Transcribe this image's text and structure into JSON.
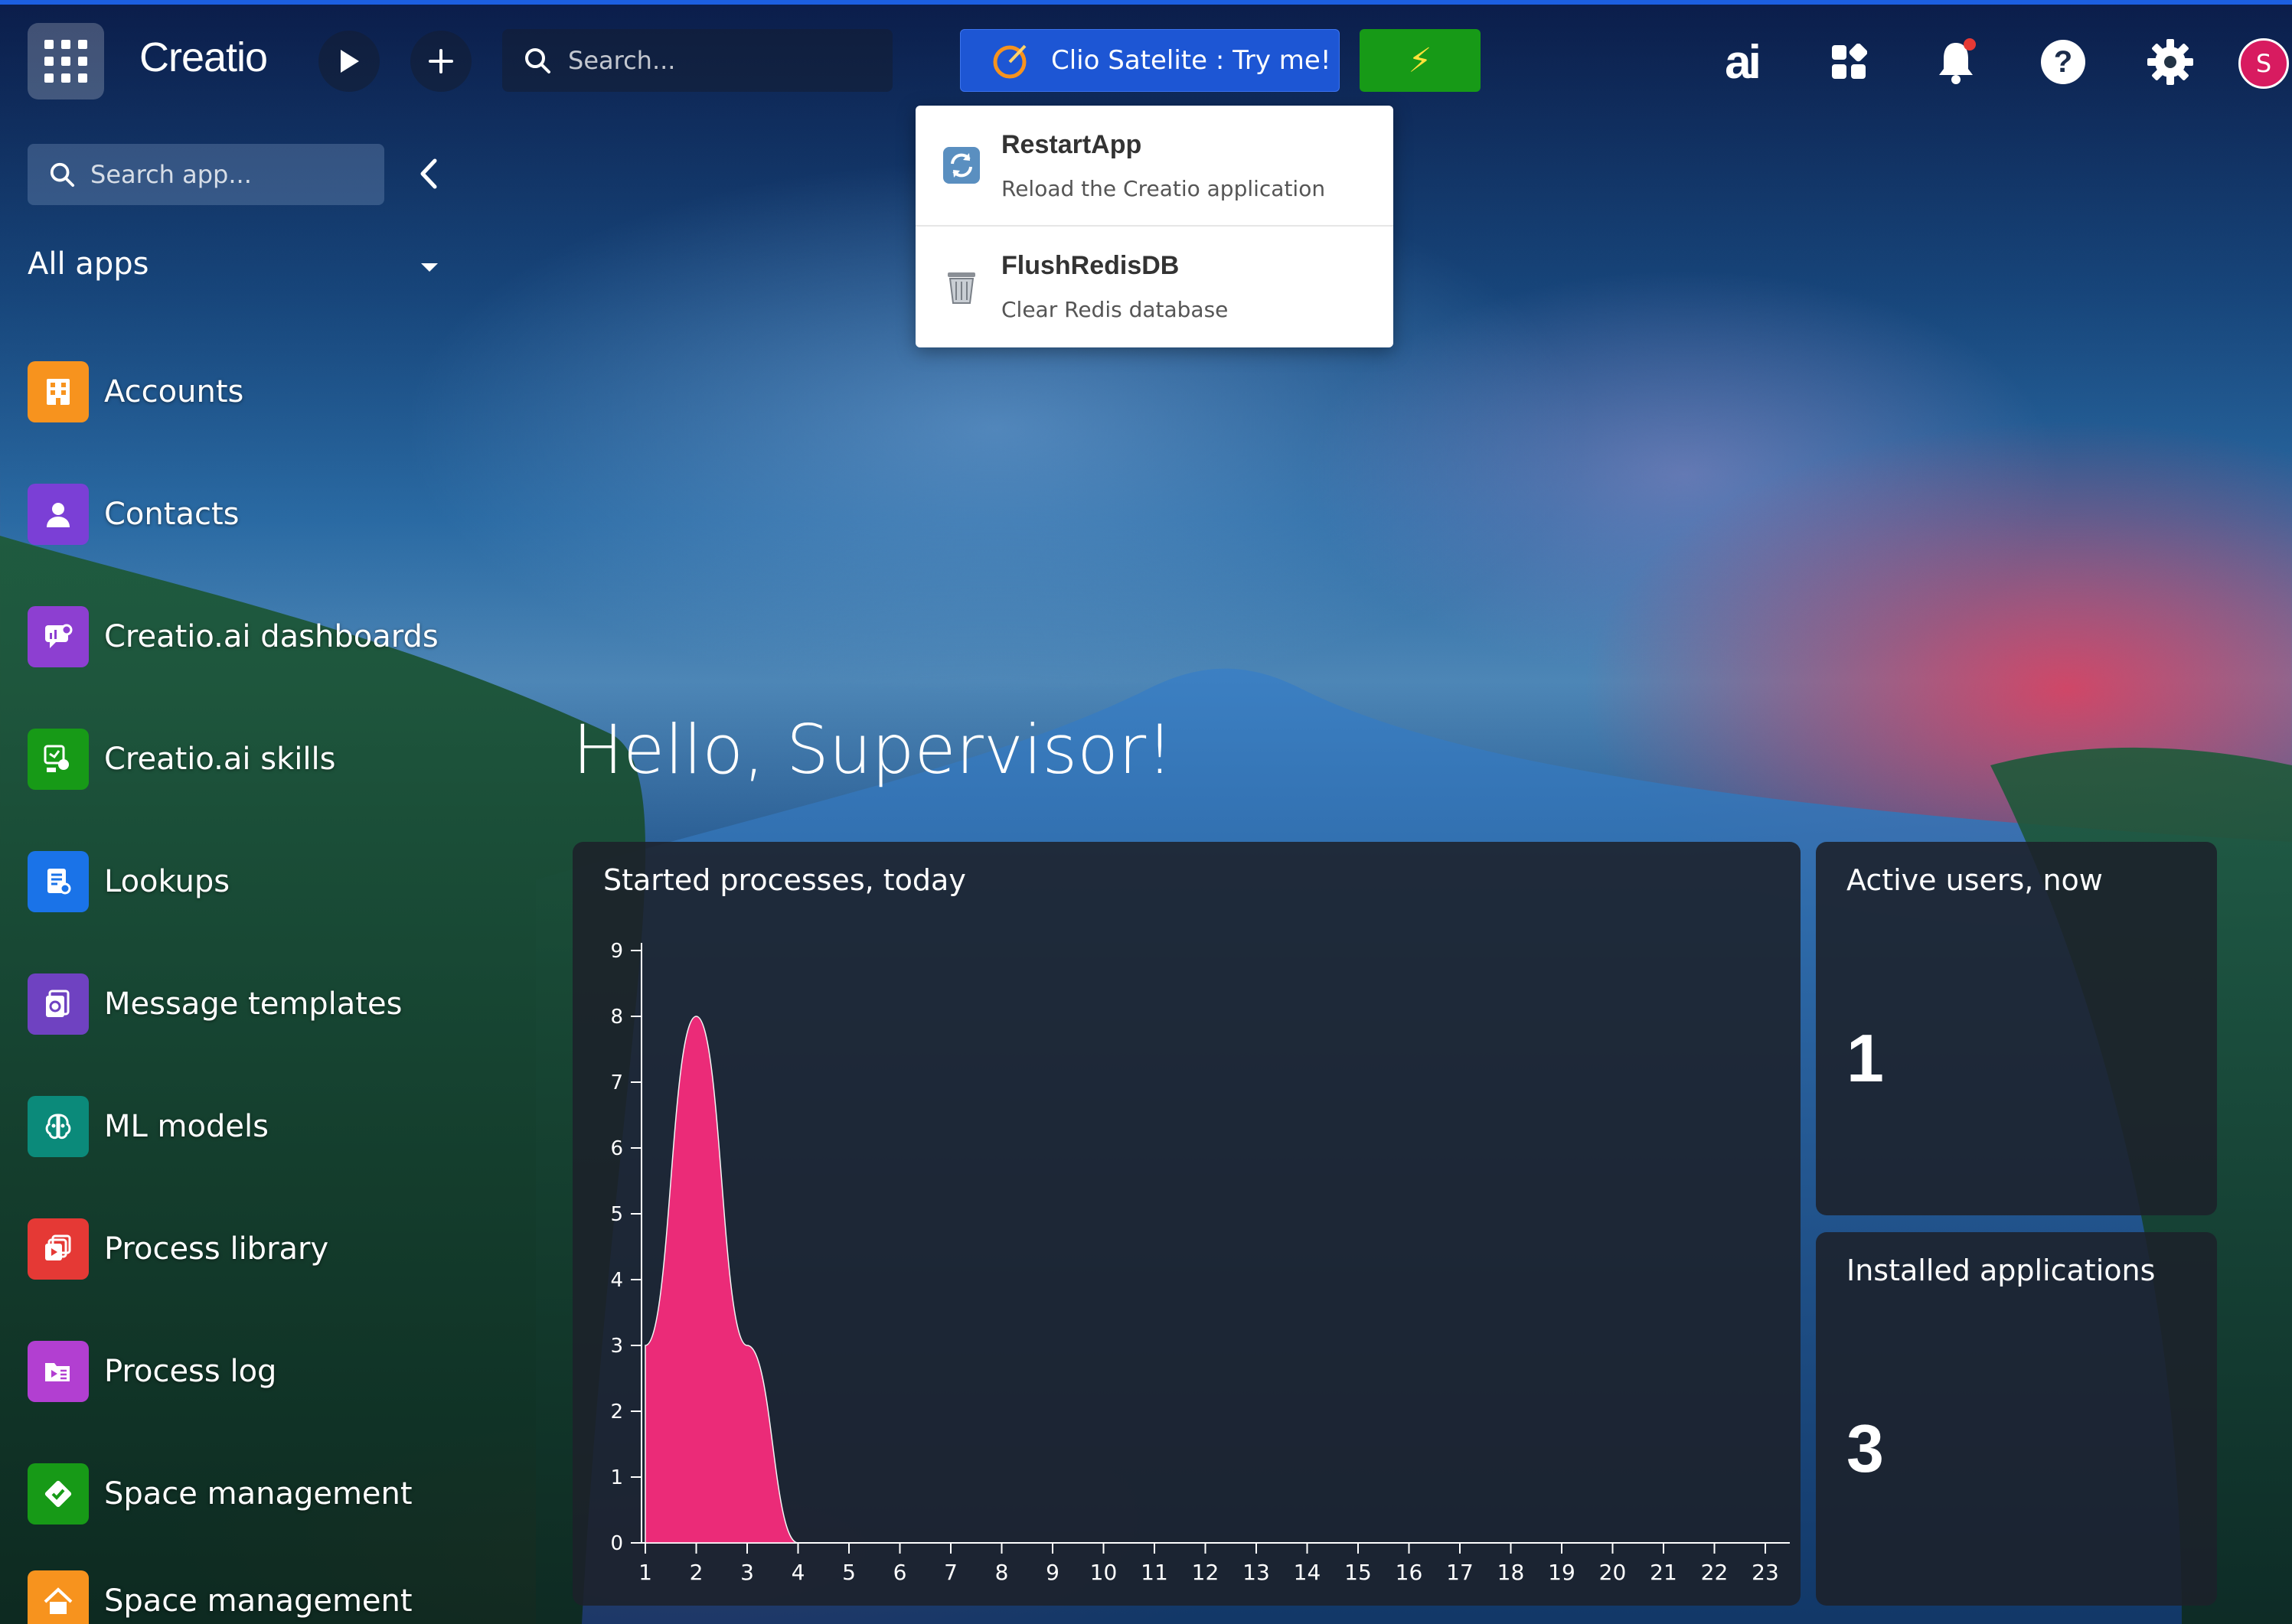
{
  "header": {
    "logo": "Creatio",
    "search_placeholder": "Search...",
    "clio_button": "Clio Satelite : Try me!",
    "bolt": "⚡",
    "ai_label": "ai",
    "avatar_initial": "S"
  },
  "dropdown": {
    "items": [
      {
        "title": "RestartApp",
        "subtitle": "Reload the Creatio application"
      },
      {
        "title": "FlushRedisDB",
        "subtitle": "Clear Redis database"
      }
    ]
  },
  "sidebar": {
    "search_placeholder": "Search app...",
    "section_title": "All apps",
    "items": [
      {
        "label": "Accounts",
        "icon": "building-icon",
        "color": "#f7931e"
      },
      {
        "label": "Contacts",
        "icon": "person-icon",
        "color": "#7b3fd6"
      },
      {
        "label": "Creatio.ai dashboards",
        "icon": "dashboard-icon",
        "color": "#8d3fd1"
      },
      {
        "label": "Creatio.ai skills",
        "icon": "skills-icon",
        "color": "#179a17"
      },
      {
        "label": "Lookups",
        "icon": "lookup-icon",
        "color": "#1a73e8"
      },
      {
        "label": "Message templates",
        "icon": "template-icon",
        "color": "#6f42c1"
      },
      {
        "label": "ML models",
        "icon": "brain-icon",
        "color": "#0b8a7a"
      },
      {
        "label": "Process library",
        "icon": "process-library-icon",
        "color": "#e53935"
      },
      {
        "label": "Process log",
        "icon": "process-log-icon",
        "color": "#b23fd1"
      },
      {
        "label": "Space management",
        "icon": "space-icon",
        "color": "#179a17"
      },
      {
        "label": "Space management",
        "icon": "home-icon",
        "color": "#f7931e"
      }
    ]
  },
  "main": {
    "greeting": "Hello, Supervisor!",
    "widgets": {
      "processes_title": "Started processes, today",
      "active_users_title": "Active users, now",
      "active_users_value": "1",
      "installed_apps_title": "Installed applications",
      "installed_apps_value": "3"
    }
  },
  "chart_data": {
    "type": "area",
    "title": "Started processes, today",
    "x": [
      1,
      2,
      3,
      4,
      5,
      6,
      7,
      8,
      9,
      10,
      11,
      12,
      13,
      14,
      15,
      16,
      17,
      18,
      19,
      20,
      21,
      22,
      23
    ],
    "values": [
      3,
      8,
      3,
      0,
      0,
      0,
      0,
      0,
      0,
      0,
      0,
      0,
      0,
      0,
      0,
      0,
      0,
      0,
      0,
      0,
      0,
      0,
      0
    ],
    "ylim": [
      0,
      9
    ],
    "yticks": [
      0,
      1,
      2,
      3,
      4,
      5,
      6,
      7,
      8,
      9
    ],
    "color": "#f72c7c",
    "grid": false
  }
}
